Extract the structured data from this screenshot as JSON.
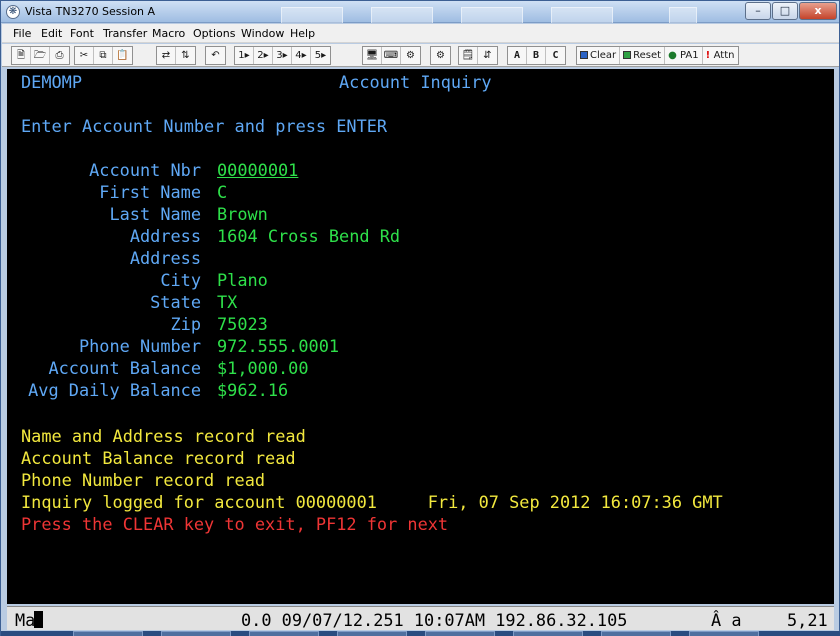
{
  "window": {
    "title": "Vista TN3270 Session A",
    "controls": {
      "minimize": "–",
      "maximize": "□",
      "close": "x"
    }
  },
  "menu": [
    "File",
    "Edit",
    "Font",
    "Transfer",
    "Macro",
    "Options",
    "Window",
    "Help"
  ],
  "toolbar": {
    "pf_keys": [
      "1▸",
      "2▸",
      "3▸",
      "4▸",
      "5▸"
    ],
    "letters": [
      "A",
      "B",
      "C"
    ],
    "clear_label": "Clear",
    "reset_label": "Reset",
    "pa1_label": "PA1",
    "attn_label": "Attn"
  },
  "terminal": {
    "app_id": "DEMOMP",
    "screen_title": "Account Inquiry",
    "instruction": "Enter Account Number and press ENTER",
    "fields": [
      {
        "label": "Account Nbr",
        "value": "00000001"
      },
      {
        "label": "First Name",
        "value": "C"
      },
      {
        "label": "Last Name",
        "value": "Brown"
      },
      {
        "label": "Address",
        "value": "1604 Cross Bend Rd"
      },
      {
        "label": "Address",
        "value": ""
      },
      {
        "label": "City",
        "value": "Plano"
      },
      {
        "label": "State",
        "value": "TX"
      },
      {
        "label": "Zip",
        "value": "75023"
      },
      {
        "label": "Phone Number",
        "value": "972.555.0001"
      },
      {
        "label": "Account Balance",
        "value": "$1,000.00"
      },
      {
        "label": "Avg Daily Balance",
        "value": "$962.16"
      }
    ],
    "messages": [
      "Name and Address record read",
      "Account Balance record read",
      "Phone Number record read",
      "Inquiry logged for account 00000001     Fri, 07 Sep 2012 16:07:36 GMT"
    ],
    "exit_message": "Press the CLEAR key to exit, PF12 for next"
  },
  "status": {
    "mode": "Ma",
    "info": "0.0 09/07/12.251 10:07AM 192.86.32.105",
    "insert_indicator": "Â a",
    "cursor_position": "5,21"
  },
  "colors": {
    "terminal_bg": "#000000",
    "label_blue": "#5fa8f5",
    "field_green": "#2ee04a",
    "message_yellow": "#f2e83e",
    "error_red": "#ef3535"
  }
}
